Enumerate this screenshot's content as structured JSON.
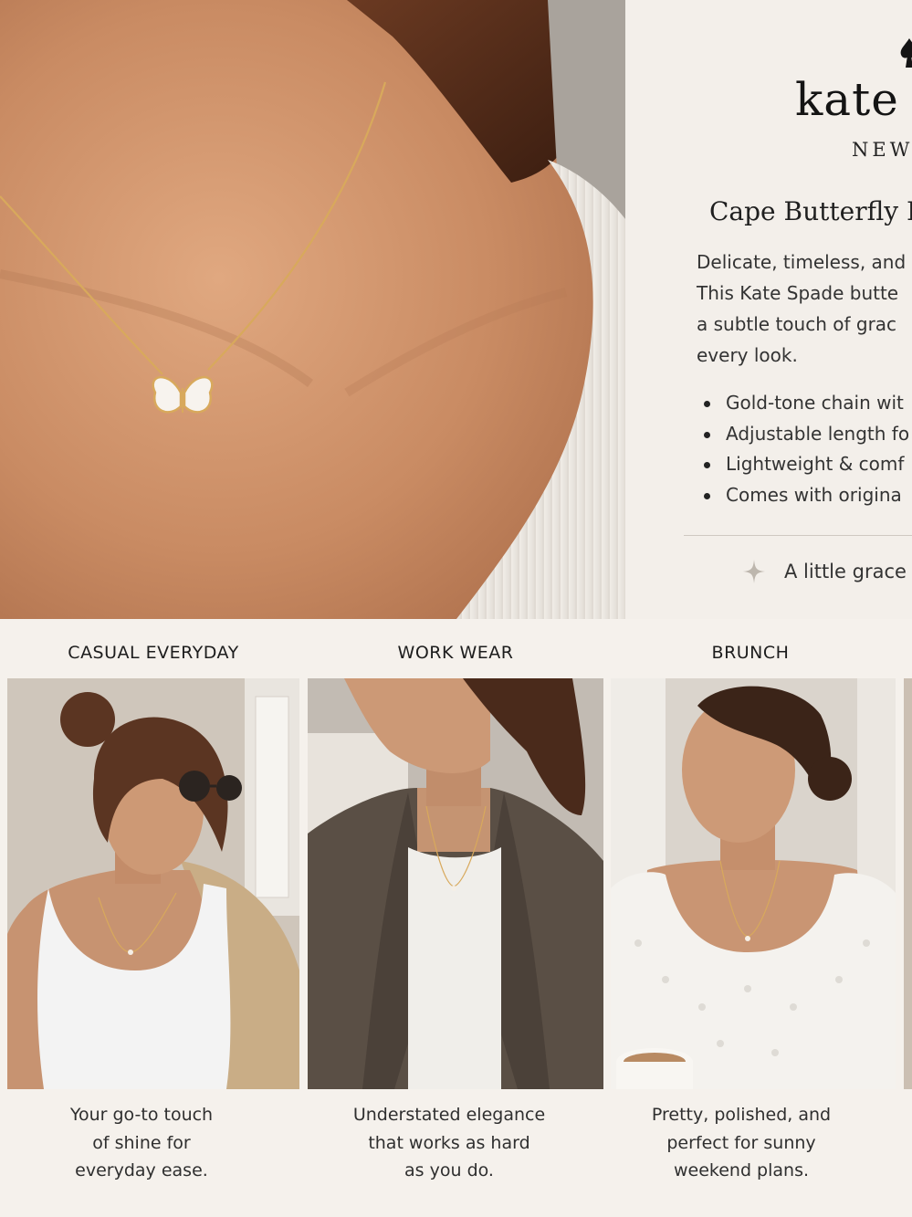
{
  "brand": {
    "name": "kate",
    "sub": "NEW"
  },
  "product": {
    "title": "Cape Butterfly P",
    "description_lines": [
      "Delicate, timeless, and",
      "This Kate Spade butte",
      "a subtle touch of grac",
      "every look."
    ],
    "features": [
      "Gold-tone chain wit",
      "Adjustable length fo",
      "Lightweight & comf",
      "Comes with origina"
    ],
    "tagline": "A little grace"
  },
  "looks": [
    {
      "label": "CASUAL EVERYDAY",
      "caption_lines": [
        "Your go-to touch",
        "of shine for",
        "everyday ease."
      ]
    },
    {
      "label": "WORK WEAR",
      "caption_lines": [
        "Understated elegance",
        "that works as hard",
        "as you do."
      ]
    },
    {
      "label": "BRUNCH",
      "caption_lines": [
        "Pretty, polished, and",
        "perfect for sunny",
        "weekend plans."
      ]
    }
  ],
  "colors": {
    "background": "#f5f1ec",
    "skin": "#c98e67",
    "gold": "#d8a95c",
    "text": "#2b2b2b"
  },
  "icons": {
    "brand": "spade-icon",
    "sparkle": "sparkle-icon"
  }
}
